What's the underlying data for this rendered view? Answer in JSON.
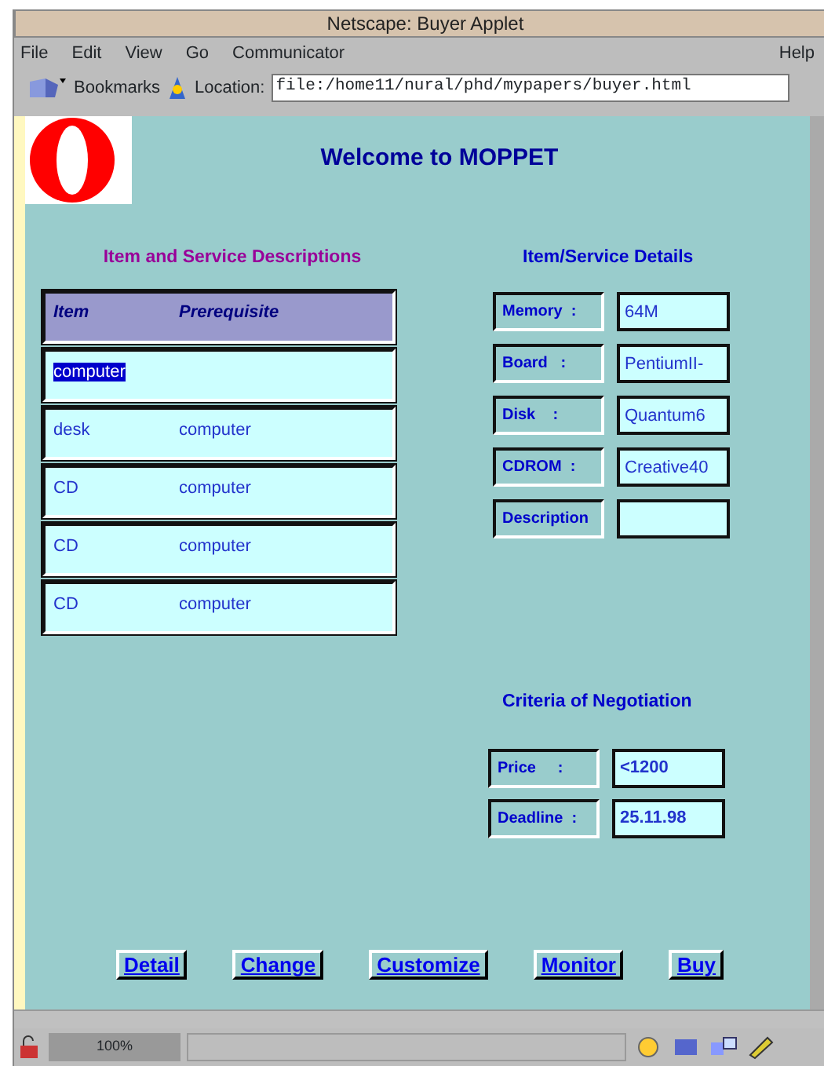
{
  "window": {
    "title": "Netscape: Buyer Applet"
  },
  "menu": [
    "File",
    "Edit",
    "View",
    "Go",
    "Communicator"
  ],
  "help_menu": "Help",
  "toolbar": {
    "bookmarks": "Bookmarks",
    "location_label": "Location:",
    "url": "file:/home11/nural/phd/mypapers/buyer.html"
  },
  "page": {
    "title": "Welcome to MOPPET",
    "descriptions": {
      "heading": "Item and Service Descriptions",
      "columns": [
        "Item",
        "Prerequisite"
      ],
      "rows": [
        {
          "item": "computer",
          "selected": true
        },
        {
          "item": "desk",
          "prerequisite": "computer",
          "selected": false
        },
        {
          "item": "CD",
          "prerequisite": "computer",
          "selected": false
        },
        {
          "item": "CD",
          "prerequisite": "computer",
          "selected": false
        },
        {
          "item": "CD",
          "prerequisite": "computer",
          "selected": false
        }
      ]
    },
    "details": {
      "heading": "Item/Service Details",
      "fields": [
        {
          "label": "Memory  :",
          "value": "64M"
        },
        {
          "label": "Board   :",
          "value": "PentiumII-"
        },
        {
          "label": "Disk    :",
          "value": "Quantum6"
        },
        {
          "label": "CDROM  :",
          "value": "Creative40"
        },
        {
          "label": "Description"
        }
      ]
    },
    "criteria": {
      "heading": "Criteria of Negotiation",
      "fields": [
        {
          "label": "Price     :",
          "value": "<1200"
        },
        {
          "label": "Deadline  :",
          "value": "25.11.98"
        }
      ]
    },
    "buttons": [
      "Detail",
      "Change",
      "Customize",
      "Monitor",
      "Buy"
    ]
  },
  "status_bar": {
    "zoom": "100%"
  }
}
